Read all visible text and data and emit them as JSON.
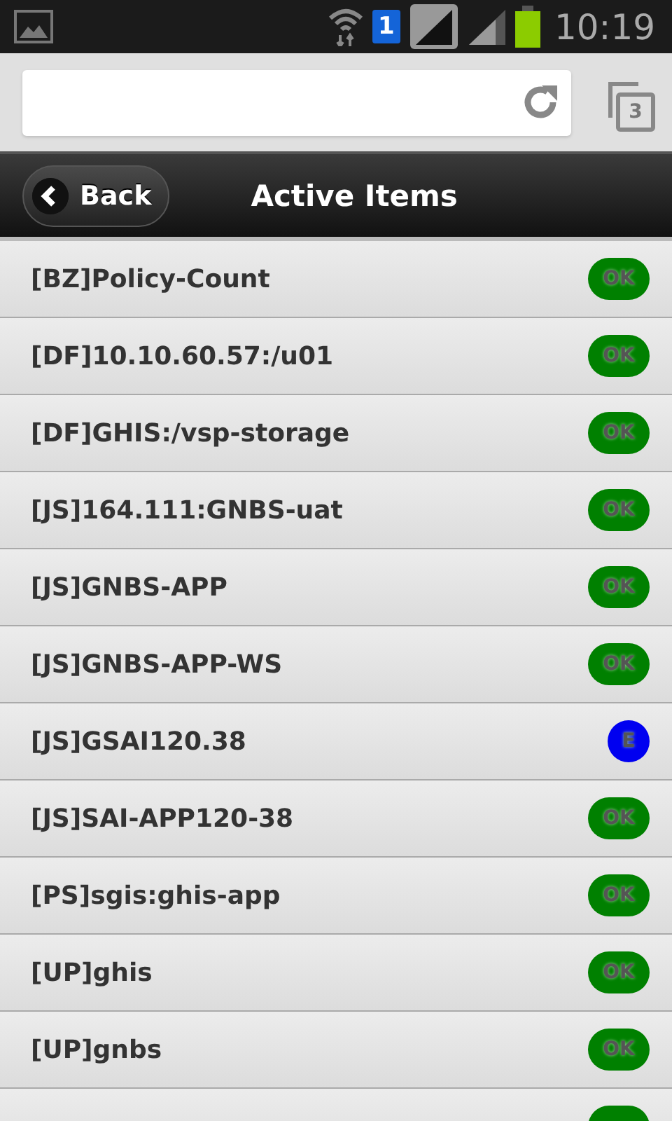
{
  "status_bar": {
    "sim_slot": "1",
    "time": "10:19"
  },
  "browser": {
    "tab_count": "3"
  },
  "header": {
    "back": "Back",
    "title": "Active Items"
  },
  "items": [
    {
      "label": "[BZ]Policy-Count",
      "kind": "ok",
      "badge": "OK"
    },
    {
      "label": "[DF]10.10.60.57:/u01",
      "kind": "ok",
      "badge": "OK"
    },
    {
      "label": "[DF]GHIS:/vsp-storage",
      "kind": "ok",
      "badge": "OK"
    },
    {
      "label": "[JS]164.111:GNBS-uat",
      "kind": "ok",
      "badge": "OK"
    },
    {
      "label": "[JS]GNBS-APP",
      "kind": "ok",
      "badge": "OK"
    },
    {
      "label": "[JS]GNBS-APP-WS",
      "kind": "ok",
      "badge": "OK"
    },
    {
      "label": "[JS]GSAI120.38",
      "kind": "error",
      "badge": "E"
    },
    {
      "label": "[JS]SAI-APP120-38",
      "kind": "ok",
      "badge": "OK"
    },
    {
      "label": "[PS]sgis:ghis-app",
      "kind": "ok",
      "badge": "OK"
    },
    {
      "label": "[UP]ghis",
      "kind": "ok",
      "badge": "OK"
    },
    {
      "label": "[UP]gnbs",
      "kind": "ok",
      "badge": "OK"
    },
    {
      "kind": "ok"
    }
  ]
}
